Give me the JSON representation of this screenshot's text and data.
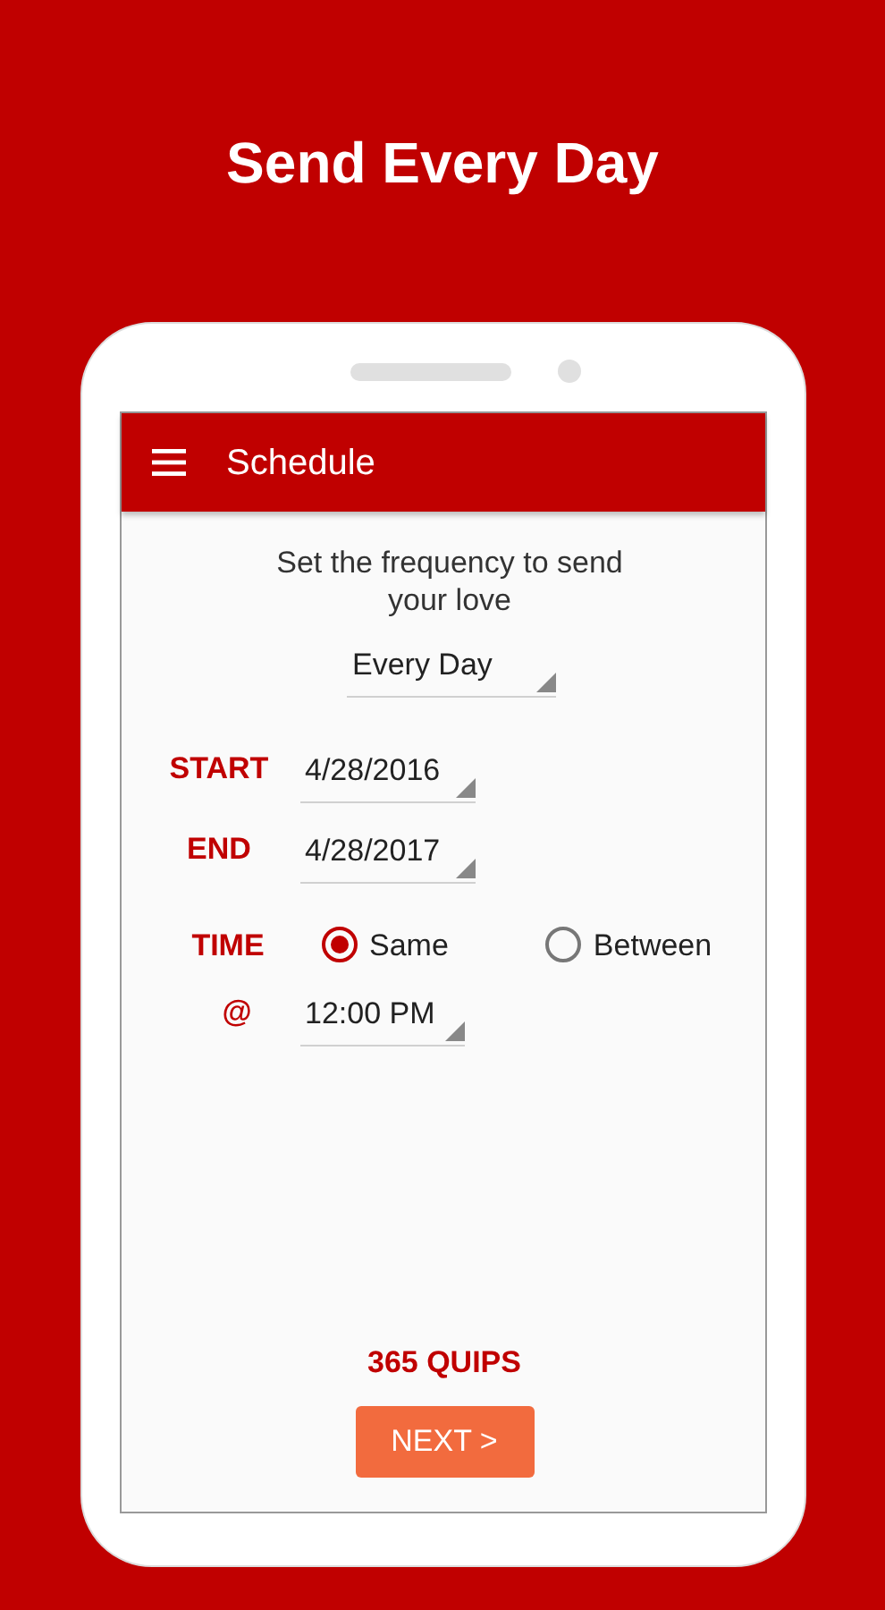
{
  "header": {
    "title": "Send Every Day"
  },
  "app_bar": {
    "title": "Schedule"
  },
  "prompt": "Set the frequency to send your love",
  "frequency": {
    "value": "Every Day"
  },
  "fields": [
    {
      "label": "START",
      "value": "4/28/2016"
    },
    {
      "label": "END",
      "value": "4/28/2017"
    }
  ],
  "time": {
    "label": "TIME",
    "options": [
      {
        "label": "Same",
        "selected": true
      },
      {
        "label": "Between",
        "selected": false
      }
    ]
  },
  "at": {
    "label": "@",
    "value": "12:00 PM"
  },
  "count": "365 QUIPS",
  "next_button": "NEXT >"
}
